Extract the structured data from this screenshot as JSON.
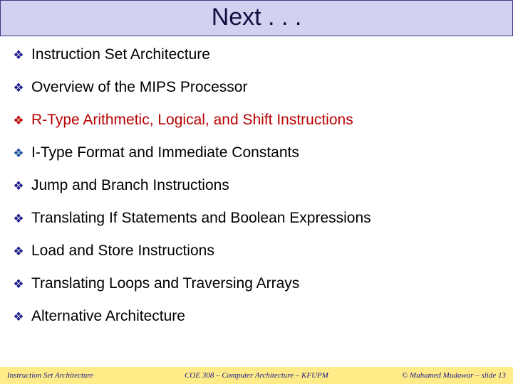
{
  "title": "Next . . .",
  "items": [
    {
      "label": "Instruction Set Architecture"
    },
    {
      "label": "Overview of the MIPS Processor"
    },
    {
      "label": "R-Type Arithmetic, Logical, and Shift Instructions"
    },
    {
      "label": "I-Type Format and Immediate Constants"
    },
    {
      "label": "Jump and Branch Instructions"
    },
    {
      "label": "Translating If Statements and Boolean Expressions"
    },
    {
      "label": "Load and Store Instructions"
    },
    {
      "label": "Translating Loops and Traversing Arrays"
    },
    {
      "label": "Alternative Architecture"
    }
  ],
  "footer": {
    "left": "Instruction Set Architecture",
    "center": "COE 308 – Computer Architecture – KFUPM",
    "right": "© Muhamed Mudawar – slide 13"
  }
}
